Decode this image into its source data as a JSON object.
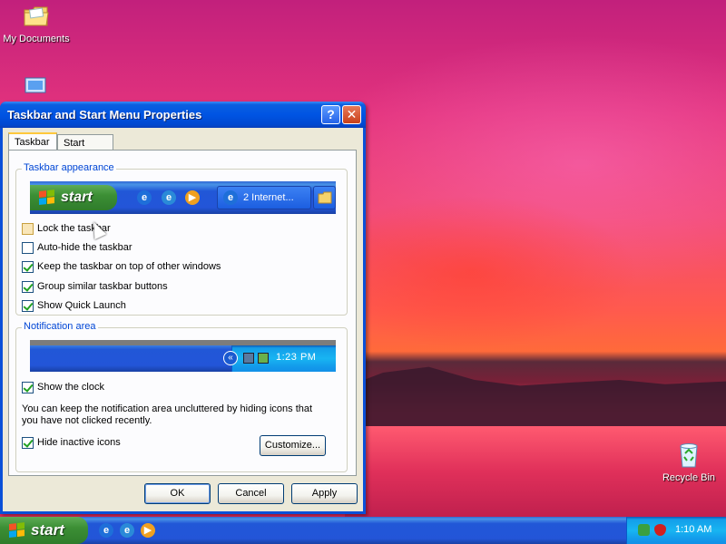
{
  "desktop": {
    "icons": {
      "my_documents": "My Documents",
      "recycle_bin": "Recycle Bin"
    }
  },
  "window": {
    "title": "Taskbar and Start Menu Properties",
    "help_glyph": "?",
    "close_glyph": "✕",
    "tabs": [
      {
        "label": "Taskbar",
        "active": true
      },
      {
        "label": "Start Menu",
        "active": false
      }
    ],
    "appearance": {
      "group_label": "Taskbar appearance",
      "preview": {
        "start_label": "start",
        "task_button_label": "2 Internet..."
      },
      "options": [
        {
          "label": "Lock the taskbar",
          "checked": false
        },
        {
          "label": "Auto-hide the taskbar",
          "checked": false
        },
        {
          "label": "Keep the taskbar on top of other windows",
          "checked": true
        },
        {
          "label": "Group similar taskbar buttons",
          "checked": true
        },
        {
          "label": "Show Quick Launch",
          "checked": true
        }
      ]
    },
    "notification": {
      "group_label": "Notification area",
      "preview_time": "1:23 PM",
      "show_clock_label": "Show the clock",
      "show_clock_checked": true,
      "description": "You can keep the notification area uncluttered by hiding icons that you have not clicked recently.",
      "hide_inactive_label": "Hide inactive icons",
      "hide_inactive_checked": true,
      "customize_label": "Customize..."
    },
    "buttons": {
      "ok": "OK",
      "cancel": "Cancel",
      "apply": "Apply"
    }
  },
  "taskbar": {
    "start_label": "start",
    "clock": "1:10 AM"
  },
  "colors": {
    "xp_blue": "#0054e3",
    "start_green": "#3c8f35",
    "group_label_blue": "#0046d5",
    "dialog_face": "#ece9d8"
  }
}
